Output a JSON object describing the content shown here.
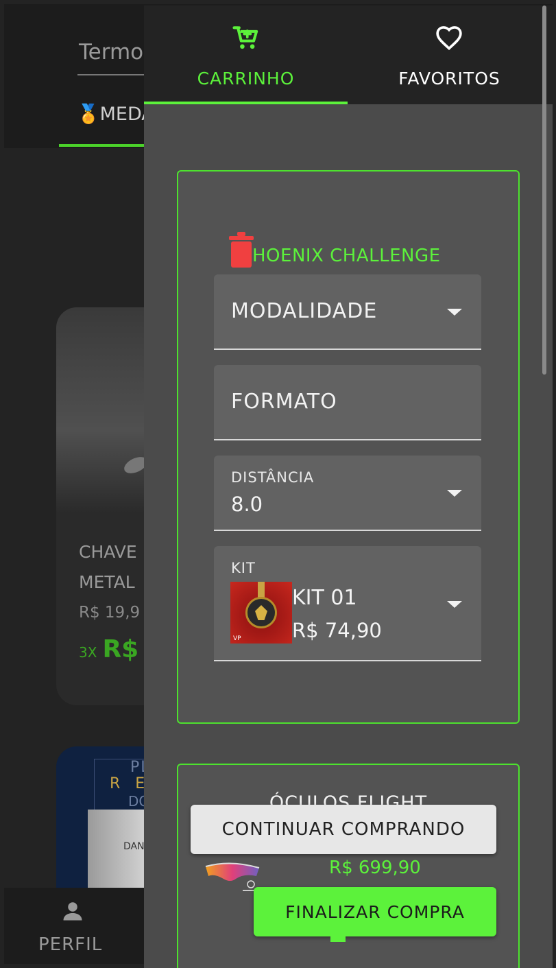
{
  "background": {
    "search_placeholder": "Termo",
    "category_tab": "🏅MEDA",
    "product_card": {
      "title": "CHAVE\nMETAL",
      "old_price": "R$ 19,9",
      "installments_prefix": "3X",
      "installments_price": "R$"
    },
    "second_card": {
      "line1": "PL",
      "line2": "RE",
      "line3": "DO",
      "line4": "DAN"
    },
    "bottom_nav": {
      "profile_label": "PERFIL"
    }
  },
  "drawer": {
    "tabs": [
      {
        "label": "CARRINHO",
        "icon": "cart-icon",
        "active": true
      },
      {
        "label": "FAVORITOS",
        "icon": "heart-icon",
        "active": false
      }
    ],
    "cart_items": [
      {
        "title": "HOENIX CHALLENGE",
        "fields": {
          "modalidade": {
            "label": "MODALIDADE"
          },
          "formato": {
            "label": "FORMATO"
          },
          "distancia": {
            "label": "DISTÂNCIA",
            "value": "8.0"
          },
          "kit": {
            "label": "KIT",
            "name": "KIT 01",
            "price": "R$ 74,90",
            "thumb_mark": "VP"
          }
        }
      },
      {
        "title": "ÓCULOS FLIGHT",
        "price": "R$ 699,90"
      }
    ],
    "buttons": {
      "continue": "CONTINUAR COMPRANDO",
      "checkout": "FINALIZAR COMPRA"
    }
  },
  "colors": {
    "accent": "#5cf23b",
    "danger": "#f04040",
    "drawer_bg": "#4b4b4b",
    "tabbar_bg": "#232323"
  }
}
